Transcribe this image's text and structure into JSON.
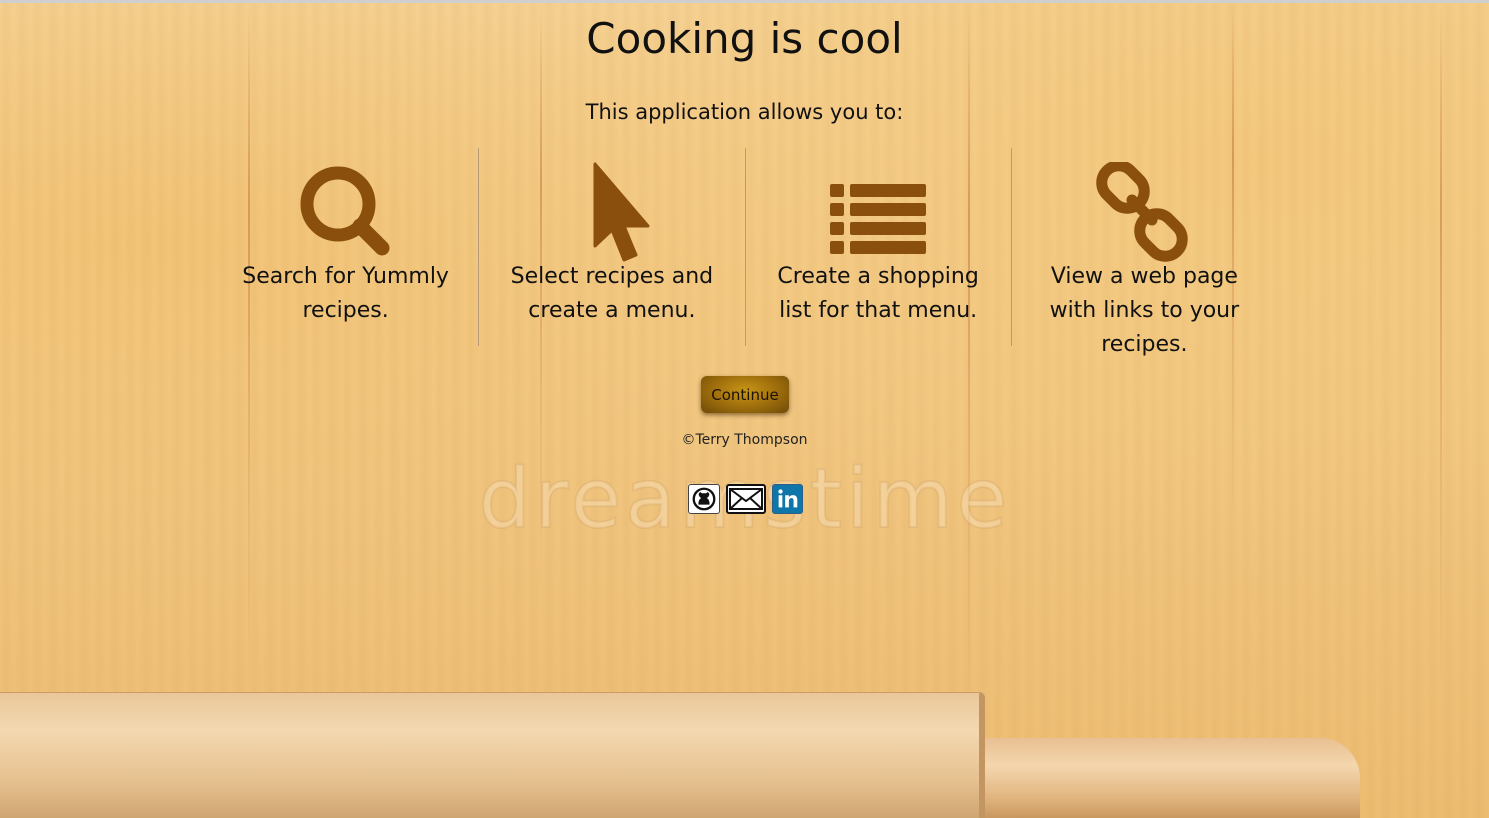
{
  "header": {
    "title": "Cooking is cool",
    "subtitle": "This application allows you to:"
  },
  "features": [
    {
      "icon": "search-icon",
      "label": "Search for Yummly recipes."
    },
    {
      "icon": "cursor-icon",
      "label": "Select recipes and create a menu."
    },
    {
      "icon": "list-icon",
      "label": "Create a shopping list for that menu."
    },
    {
      "icon": "link-icon",
      "label": "View a web page with links to your recipes."
    }
  ],
  "actions": {
    "continue_label": "Continue"
  },
  "footer": {
    "copyright": "©Terry Thompson",
    "social": [
      {
        "icon": "github-icon"
      },
      {
        "icon": "email-icon"
      },
      {
        "icon": "linkedin-icon"
      }
    ]
  },
  "background_watermark": "dreamstime",
  "colors": {
    "icon_brown": "#8a4f0c",
    "button_gold": "#b07d10",
    "wood": "#f1c680",
    "linkedin_blue": "#0e76a8"
  }
}
